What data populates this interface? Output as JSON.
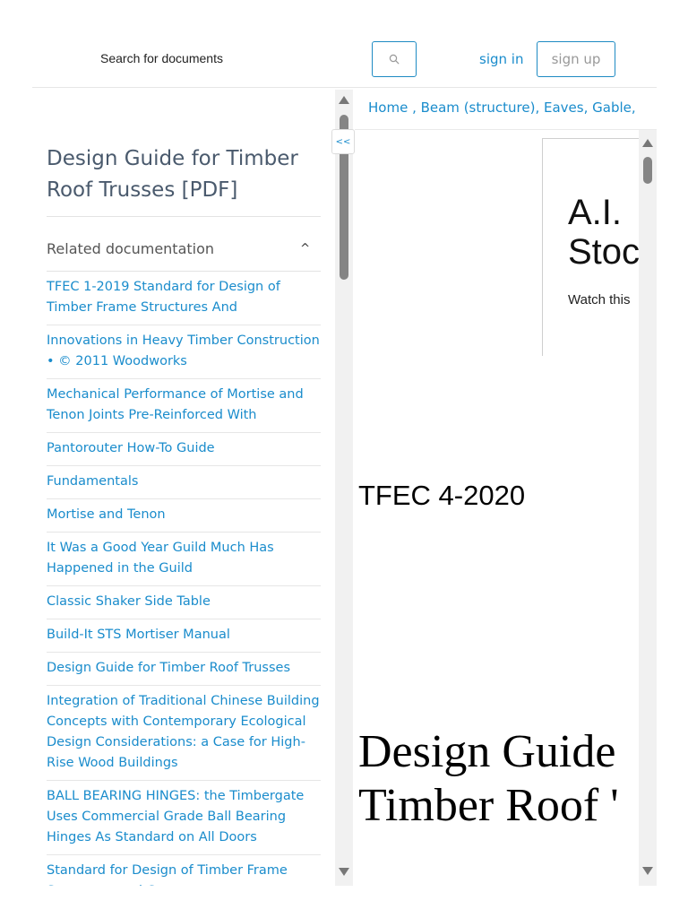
{
  "header": {
    "search_label": "Search for documents",
    "search_icon": "search-icon",
    "signin": "sign in",
    "signup": "sign up"
  },
  "sidebar": {
    "title": "Design Guide for Timber Roof Trusses [PDF]",
    "related_label": "Related documentation",
    "caret": "^",
    "links": [
      "TFEC 1-2019 Standard for Design of Timber Frame Structures And",
      "Innovations in Heavy Timber Construction • © 2011 Woodworks",
      "Mechanical Performance of Mortise and Tenon Joints Pre-Reinforced With",
      "Pantorouter How-To Guide",
      "Fundamentals",
      "Mortise and Tenon",
      "It Was a Good Year Guild Much Has Happened in the Guild",
      "Classic Shaker Side Table",
      "Build-It STS Mortiser Manual",
      "Design Guide for Timber Roof Trusses",
      "Integration of Traditional Chinese Building Concepts with Contemporary Ecological Design Considerations: a Case for High-Rise Wood Buildings",
      "BALL BEARING HINGES: the Timbergate Uses Commercial Grade Ball Bearing Hinges As Standard on All Doors",
      "Standard for Design of Timber Frame Structures and Commentary"
    ]
  },
  "collapse_label": "<<",
  "breadcrumb": "Home , Beam (structure), Eaves, Gable,",
  "viewer": {
    "ad_title_line1": "A.I.",
    "ad_title_line2": "Stoc",
    "ad_subtitle": "Watch this",
    "doc_code": "TFEC 4-2020",
    "doc_heading_line1": "Design Guide",
    "doc_heading_line2": "Timber Roof '"
  },
  "colors": {
    "link": "#1a8ccc",
    "title": "#4a5a6d",
    "border": "#1e8bc3"
  }
}
